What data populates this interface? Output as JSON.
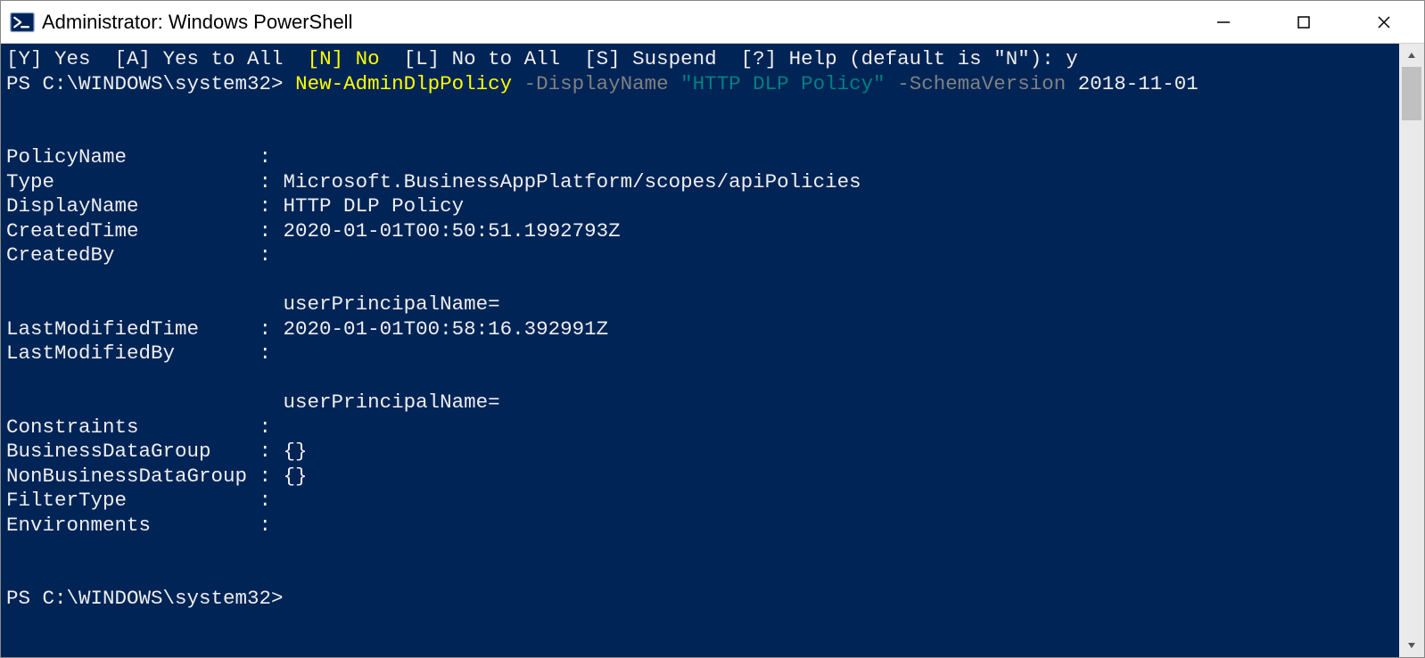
{
  "window": {
    "title": "Administrator: Windows PowerShell"
  },
  "prompt_line": {
    "options": "[Y] Yes  [A] Yes to All  ",
    "default_n": "[N] No",
    "rest": "  [L] No to All  [S] Suspend  [?] Help (default is \"N\"): y"
  },
  "command_line": {
    "prompt": "PS C:\\WINDOWS\\system32> ",
    "cmd": "New-AdminDlpPolicy",
    "param1": " -DisplayName ",
    "value1": "\"HTTP DLP Policy\"",
    "param2": " -SchemaVersion ",
    "value2": "2018-11-01"
  },
  "output_lines": [
    "",
    "",
    "PolicyName           :",
    "Type                 : Microsoft.BusinessAppPlatform/scopes/apiPolicies",
    "DisplayName          : HTTP DLP Policy",
    "CreatedTime          : 2020-01-01T00:50:51.1992793Z",
    "CreatedBy            :",
    "",
    "                       userPrincipalName=",
    "LastModifiedTime     : 2020-01-01T00:58:16.392991Z",
    "LastModifiedBy       :",
    "",
    "                       userPrincipalName=",
    "Constraints          :",
    "BusinessDataGroup    : {}",
    "NonBusinessDataGroup : {}",
    "FilterType           :",
    "Environments         :",
    "",
    ""
  ],
  "final_prompt": "PS C:\\WINDOWS\\system32>"
}
